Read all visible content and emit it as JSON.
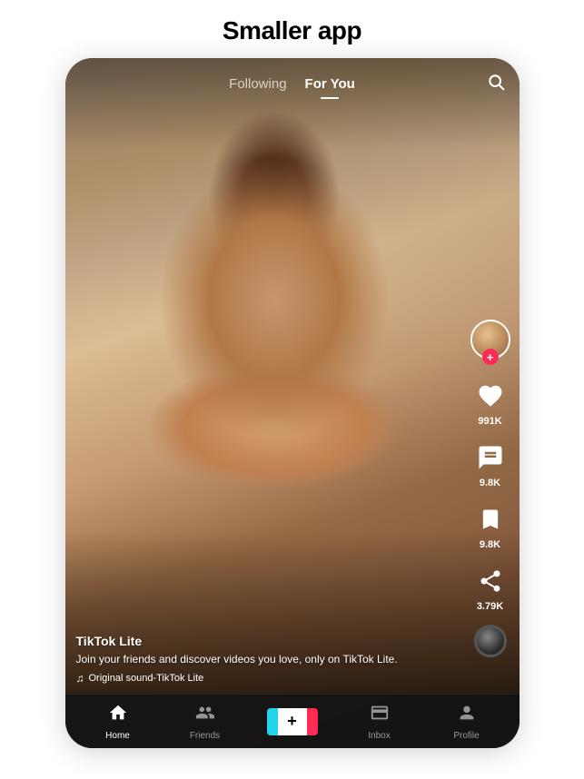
{
  "page": {
    "title": "Smaller app"
  },
  "header": {
    "tabs": [
      {
        "label": "Following",
        "active": false
      },
      {
        "label": "For You",
        "active": true
      }
    ],
    "search_label": "Search"
  },
  "actions": {
    "avatar_alt": "User avatar",
    "follow_plus": "+",
    "like": {
      "icon": "♥",
      "count": "991K"
    },
    "comment": {
      "count": "9.8K"
    },
    "bookmark": {
      "count": "9.8K"
    },
    "share": {
      "count": "3.79K"
    }
  },
  "video_info": {
    "username": "TikTok Lite",
    "description": "Join your friends and discover videos you love, only on TikTok Lite.",
    "sound": "Original sound-TikTok Lite"
  },
  "bottom_nav": [
    {
      "label": "Home",
      "icon": "⌂",
      "active": true
    },
    {
      "label": "Friends",
      "icon": "👤",
      "active": false
    },
    {
      "label": "+",
      "icon": "+",
      "active": false,
      "is_add": true
    },
    {
      "label": "Inbox",
      "icon": "▣",
      "active": false
    },
    {
      "label": "Profile",
      "icon": "○",
      "active": false
    }
  ]
}
